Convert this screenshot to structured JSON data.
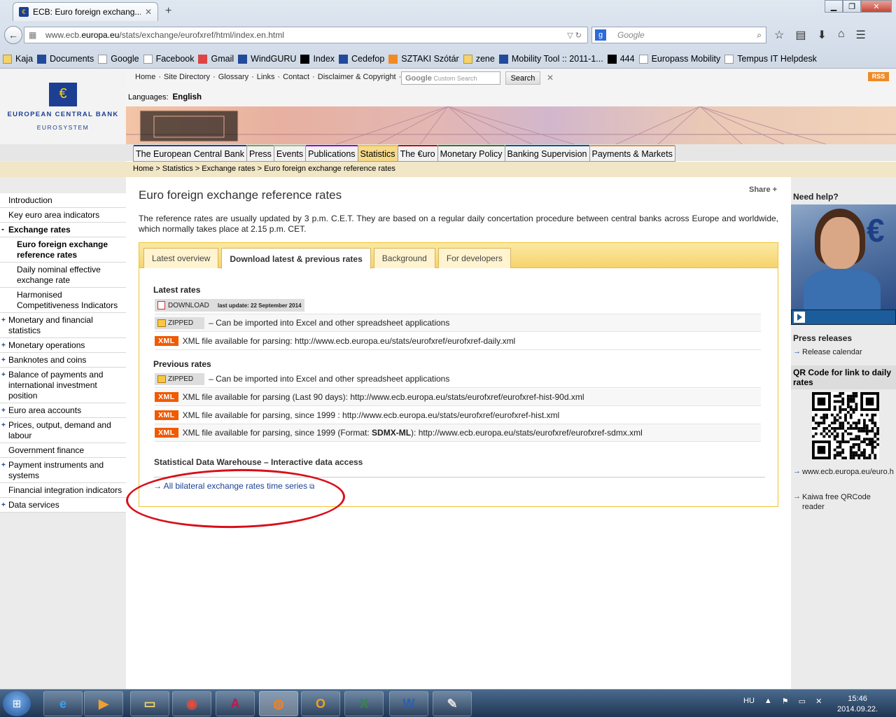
{
  "browser": {
    "tab_title": "ECB: Euro foreign exchang...",
    "url_plain": "www.ecb.",
    "url_bold": "europa.eu",
    "url_rest": "/stats/exchange/eurofxref/html/index.en.html",
    "search_placeholder": "Google",
    "bookmarks": [
      "Kaja",
      "Documents",
      "Google",
      "Facebook",
      "Gmail",
      "WindGURU",
      "Index",
      "Cedefop",
      "SZTAKI Szótár",
      "zene",
      "Mobility Tool :: 2011-1...",
      "444",
      "Europass Mobility",
      "Tempus IT Helpdesk"
    ]
  },
  "header": {
    "logo_name": "EUROPEAN CENTRAL BANK",
    "logo_sub": "EUROSYSTEM",
    "top_links": [
      "Home",
      "·",
      "Site Directory",
      "·",
      "Glossary",
      "·",
      "Links",
      "·",
      "Contact",
      "·",
      "Disclaimer & Copyright",
      "·"
    ],
    "search_google": "Google",
    "search_placeholder": "Custom Search",
    "search_button": "Search",
    "rss": "RSS",
    "languages_label": "Languages:",
    "language": "English"
  },
  "main_nav": [
    {
      "label": "The European Central Bank",
      "color": "#1c3f94"
    },
    {
      "label": "Press",
      "color": "#6aa84f"
    },
    {
      "label": "Events",
      "color": "#93c47d"
    },
    {
      "label": "Publications",
      "color": "#9900cc"
    },
    {
      "label": "Statistics",
      "color": "#f1c232"
    },
    {
      "label": "The €uro",
      "color": "#cc0000"
    },
    {
      "label": "Monetary Policy",
      "color": "#38761d"
    },
    {
      "label": "Banking Supervision",
      "color": "#0b5394"
    },
    {
      "label": "Payments & Markets",
      "color": "#e69138"
    }
  ],
  "breadcrumb": [
    "Home",
    ">",
    "Statistics",
    ">",
    "Exchange rates",
    ">",
    "Euro foreign exchange reference rates"
  ],
  "sidebar": {
    "items": [
      {
        "label": "Introduction",
        "kind": ""
      },
      {
        "label": "Key euro area indicators",
        "kind": ""
      },
      {
        "label": "Exchange rates",
        "kind": "minus sec"
      },
      {
        "label": "Euro foreign exchange reference rates",
        "kind": "sub cur"
      },
      {
        "label": "Daily nominal effective exchange rate",
        "kind": "sub"
      },
      {
        "label": "Harmonised Competitiveness Indicators",
        "kind": "sub"
      },
      {
        "label": "Monetary and financial statistics",
        "kind": "plus"
      },
      {
        "label": "Monetary operations",
        "kind": "plus"
      },
      {
        "label": "Banknotes and coins",
        "kind": "plus"
      },
      {
        "label": "Balance of payments and international investment position",
        "kind": "plus"
      },
      {
        "label": "Euro area accounts",
        "kind": "plus"
      },
      {
        "label": "Prices, output, demand and labour",
        "kind": "plus"
      },
      {
        "label": "Government finance",
        "kind": ""
      },
      {
        "label": "Payment instruments and systems",
        "kind": "plus"
      },
      {
        "label": "Financial integration indicators",
        "kind": ""
      },
      {
        "label": "Data services",
        "kind": "plus"
      }
    ]
  },
  "main": {
    "title": "Euro foreign exchange reference rates",
    "share": "Share +",
    "intro": "The reference rates are usually updated by 3 p.m. C.E.T. They are based on a regular daily concertation procedure between central banks across Europe and worldwide, which normally takes place at 2.15 p.m. CET.",
    "tabs": [
      "Latest overview",
      "Download latest & previous rates",
      "Background",
      "For developers"
    ],
    "latest_heading": "Latest rates",
    "download_label": "DOWNLOAD",
    "last_update": "last update: 22 September 2014",
    "zipped_label": "ZIPPED",
    "zipped_desc": "– Can be imported into Excel and other spreadsheet applications",
    "xml_label": "XML",
    "xml_daily": "XML file available for parsing: http://www.ecb.europa.eu/stats/eurofxref/eurofxref-daily.xml",
    "previous_heading": "Previous rates",
    "xml_90d": "XML file available for parsing (Last 90 days): http://www.ecb.europa.eu/stats/eurofxref/eurofxref-hist-90d.xml",
    "xml_hist": "XML file available for parsing, since 1999 : http://www.ecb.europa.eu/stats/eurofxref/eurofxref-hist.xml",
    "xml_sdmx_pre": "XML file available for parsing, since 1999 (Format: ",
    "xml_sdmx_bold": "SDMX-ML",
    "xml_sdmx_post": "): http://www.ecb.europa.eu/stats/eurofxref/eurofxref-sdmx.xml",
    "sdw_heading": "Statistical Data Warehouse – Interactive data access",
    "bilateral_link": "All bilateral exchange rates time series"
  },
  "right": {
    "help": "Need help?",
    "press_heading": "Press releases",
    "release_calendar": "Release calendar",
    "qr_heading": "QR Code for link to daily rates",
    "qr_link": "www.ecb.europa.eu/euro.h",
    "kaiwa": "Kaiwa free QRCode reader"
  },
  "taskbar": {
    "lang": "HU",
    "time": "15:46",
    "date": "2014.09.22."
  }
}
